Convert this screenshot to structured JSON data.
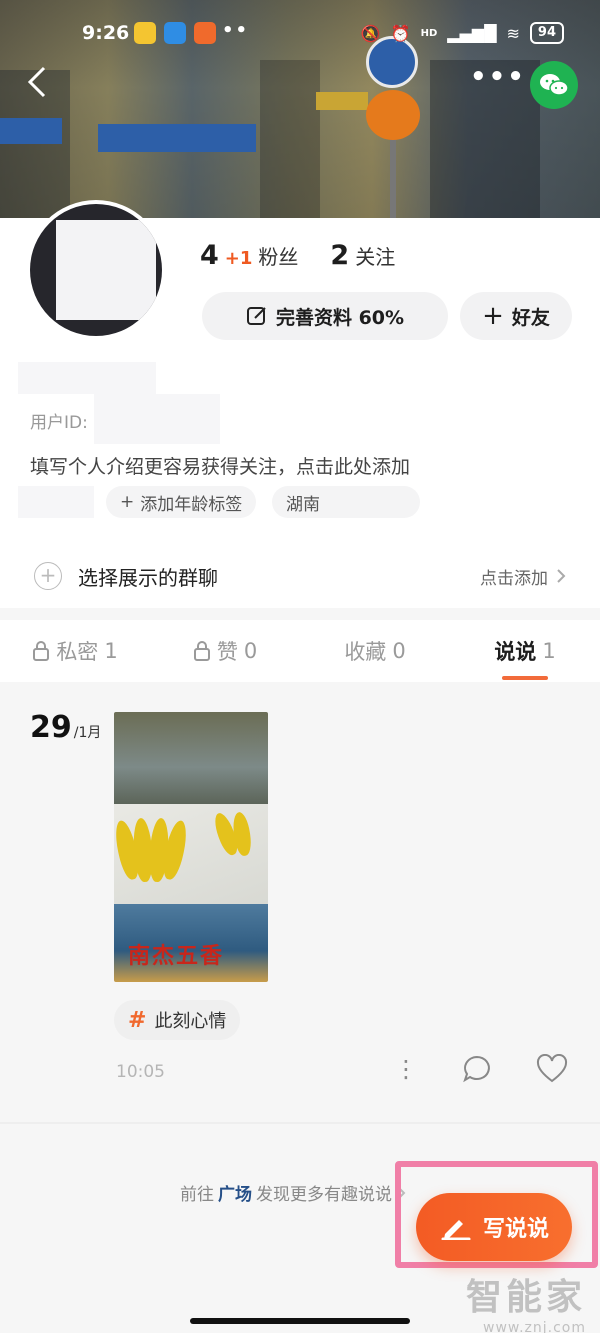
{
  "status_bar": {
    "time": "9:26",
    "more_dots": "••",
    "network": "HD",
    "battery": "94"
  },
  "header": {
    "back_icon": "chevron-left-icon",
    "more_label": "•••",
    "share_icon": "wechat-icon"
  },
  "profile": {
    "followers_count": "4",
    "followers_increment": "+1",
    "followers_label": "粉丝",
    "following_count": "2",
    "following_label": "关注",
    "complete_profile_label": "完善资料 60%",
    "add_friend_label": "好友",
    "user_id_label": "用户ID:",
    "bio_prompt": "填写个人介绍更容易获得关注，点击此处添加",
    "age_tag_label": "添加年龄标签",
    "location_tag": "湖南",
    "group_label": "选择展示的群聊",
    "group_action": "点击添加"
  },
  "tabs": [
    {
      "label": "私密",
      "count": "1",
      "locked": true
    },
    {
      "label": "赞",
      "count": "0",
      "locked": true
    },
    {
      "label": "收藏",
      "count": "0",
      "locked": false
    },
    {
      "label": "说说",
      "count": "1",
      "locked": false,
      "active": true
    }
  ],
  "post": {
    "day": "29",
    "month": "/1月",
    "thumbnail_caption": "南杰五香",
    "topic": "此刻心情",
    "time": "10:05"
  },
  "footer": {
    "discover_prefix": "前往",
    "discover_highlight": "广场",
    "discover_suffix": "发现更多有趣说说",
    "write_button_label": "写说说"
  },
  "watermark": {
    "brand": "智能家",
    "url": "www.znj.com"
  },
  "colors": {
    "accent": "#f35b24",
    "highlight_box": "#f07fa7",
    "wechat_green": "#1fb352"
  }
}
